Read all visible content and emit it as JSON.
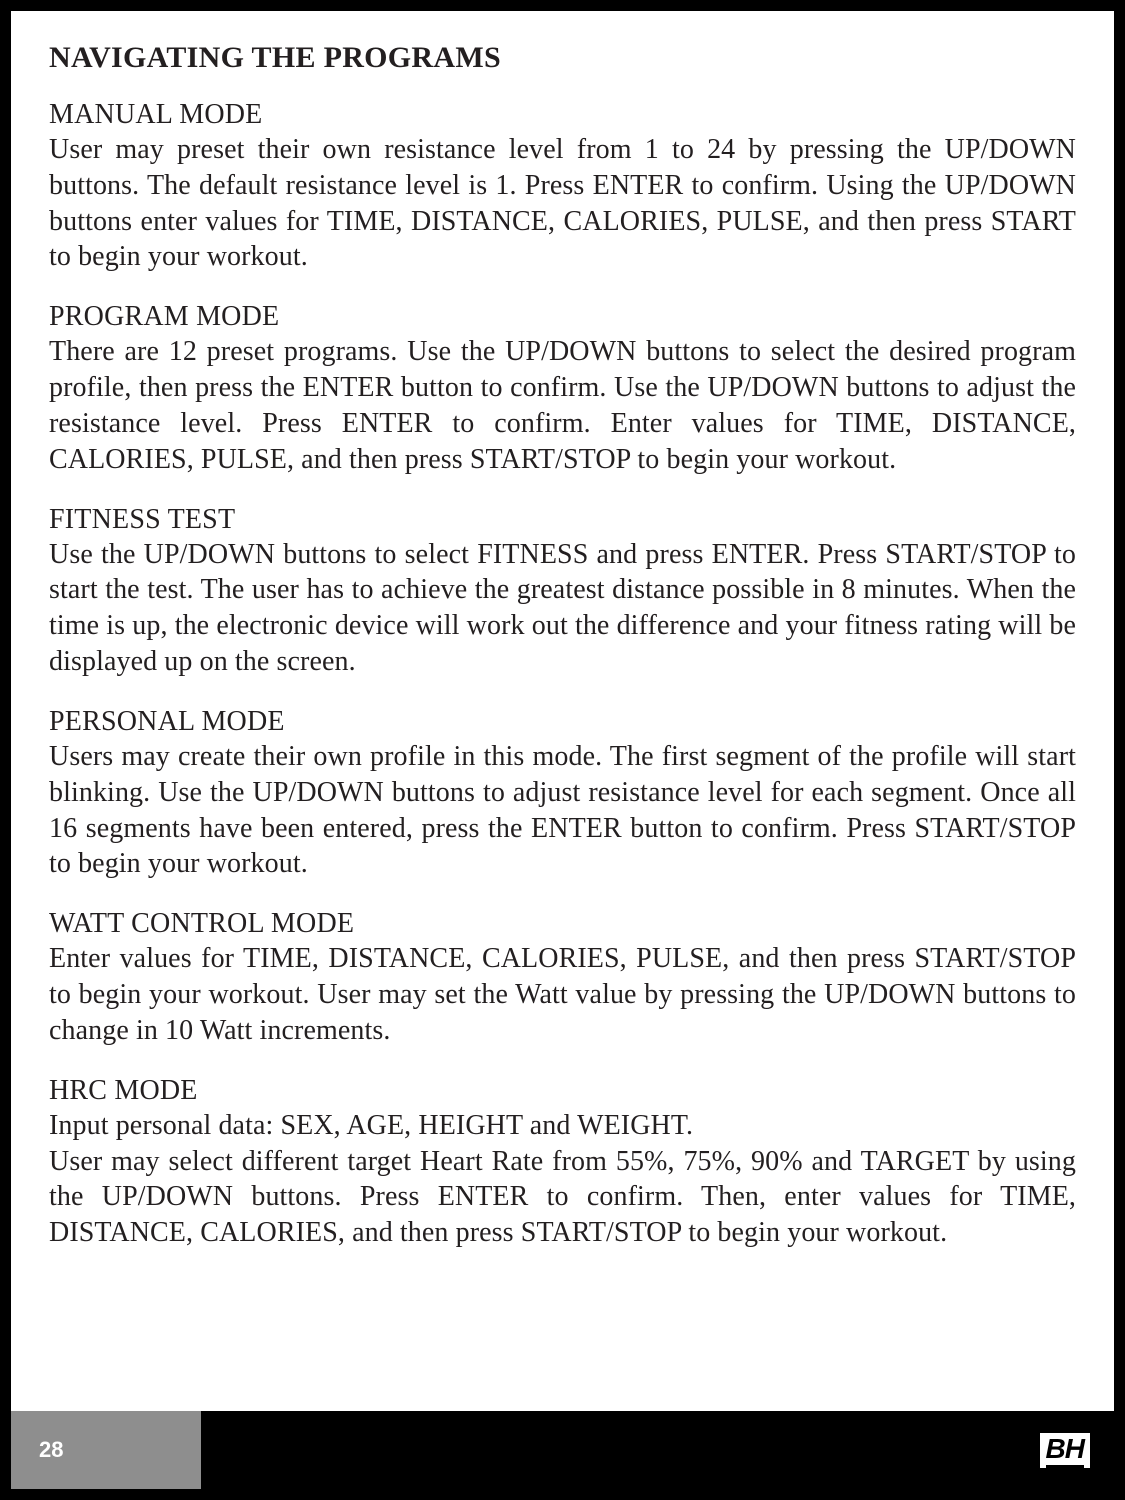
{
  "title": "NAVIGATING THE PROGRAMS",
  "sections": [
    {
      "head": "MANUAL MODE",
      "body": "User may preset their own resistance level from 1 to 24 by pressing the UP/DOWN buttons. The default resistance level is 1. Press ENTER to confirm. Using the UP/DOWN buttons enter values for TIME, DISTANCE, CALORIES, PULSE, and then press START to begin your workout."
    },
    {
      "head": "PROGRAM MODE",
      "body": "There are 12 preset programs. Use the UP/DOWN buttons to select the desired program profile, then press the ENTER button to confirm. Use the UP/DOWN buttons to adjust the resistance level. Press ENTER to confirm. Enter values for TIME, DISTANCE, CALORIES, PULSE, and then press START/STOP to begin your workout."
    },
    {
      "head": "FITNESS TEST",
      "body": "Use the UP/DOWN buttons to select FITNESS and press ENTER. Press START/STOP to start the test. The user has to achieve the greatest distance possible in 8 minutes. When the time is up, the electronic device will work out the difference and your fitness rating will be displayed up on the screen."
    },
    {
      "head": "PERSONAL MODE",
      "body": "Users may create their own profile in this mode. The first segment of the profile will start blinking. Use the UP/DOWN buttons to adjust resistance level for each segment. Once all 16 segments have been entered, press the ENTER button to confirm. Press START/STOP to begin your workout."
    },
    {
      "head": "WATT CONTROL MODE",
      "body": "Enter values for TIME, DISTANCE, CALORIES, PULSE, and then press START/STOP to begin your workout. User may set the Watt value by pressing the UP/DOWN buttons to change in 10 Watt increments."
    },
    {
      "head": "HRC MODE",
      "body": "Input personal data: SEX, AGE, HEIGHT and WEIGHT.\nUser may select different target Heart Rate from 55%, 75%, 90% and TARGET by using the UP/DOWN buttons. Press ENTER to confirm. Then, enter values for TIME, DISTANCE, CALORIES, and then press START/STOP to begin your workout."
    }
  ],
  "footer": {
    "page_number": "28",
    "logo_text": "BH"
  }
}
